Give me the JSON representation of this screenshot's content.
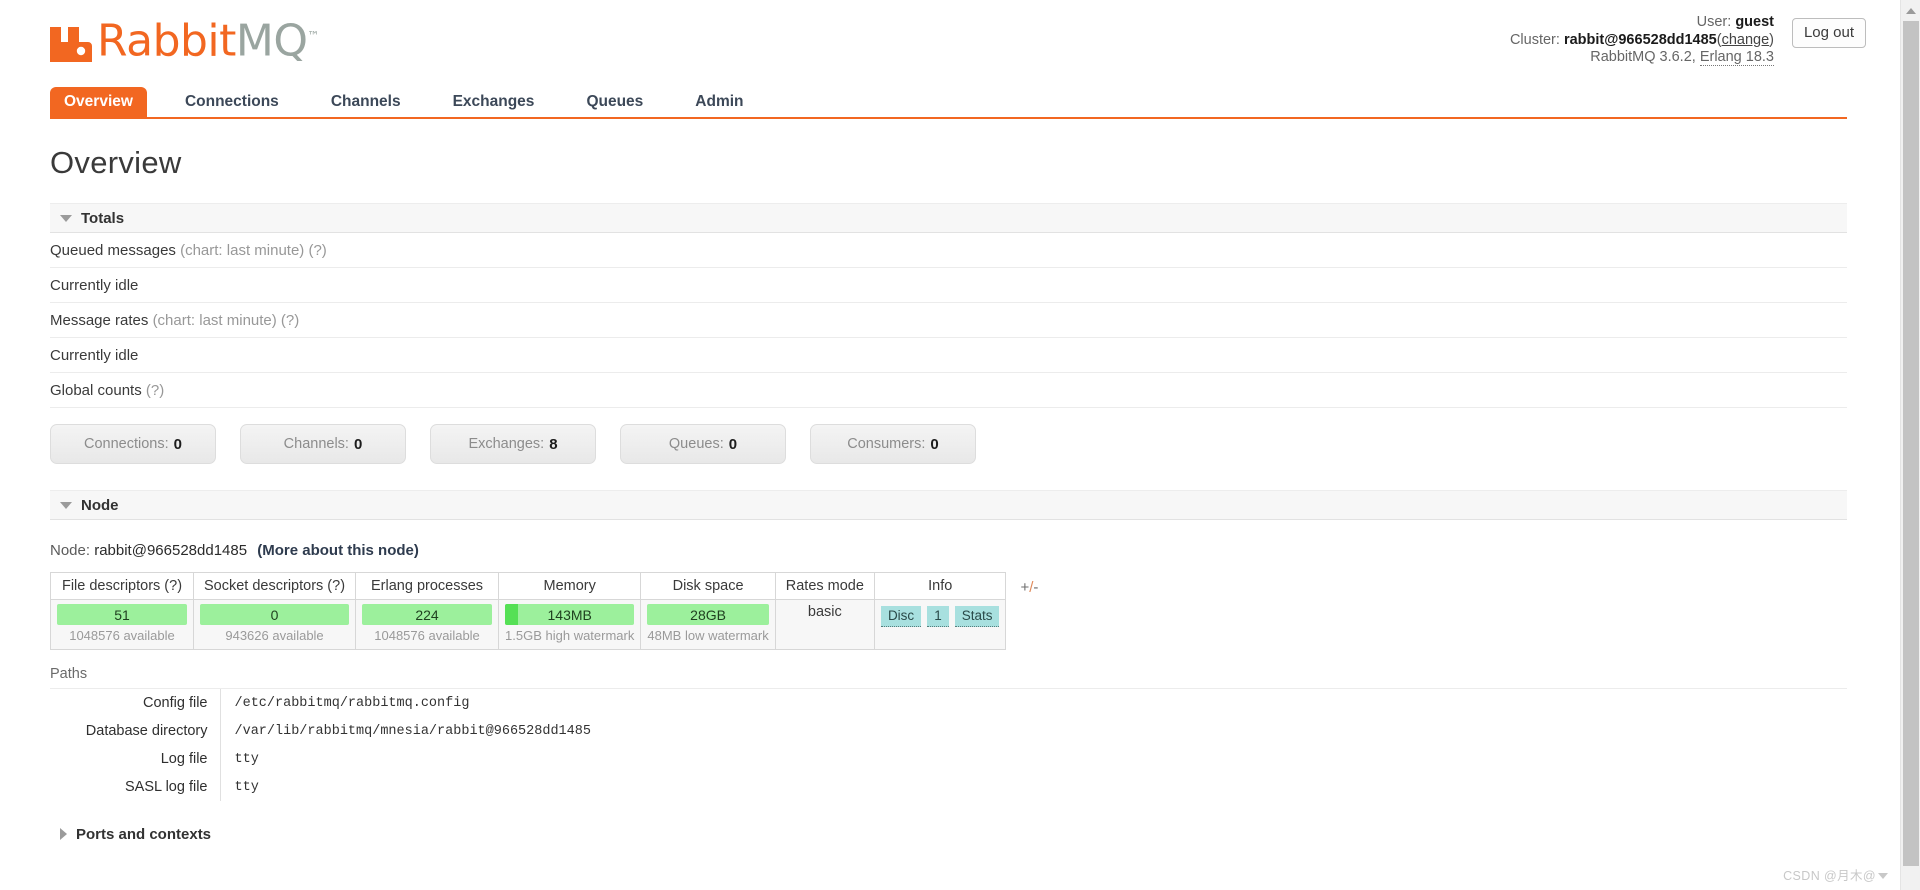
{
  "brand": {
    "name_primary": "Rabbit",
    "name_secondary": "MQ",
    "trademark": "™",
    "accent_color": "#f26721",
    "secondary_color": "#9aa5a0"
  },
  "header": {
    "user_label": "User:",
    "user_value": "guest",
    "cluster_label": "Cluster:",
    "cluster_value": "rabbit@966528dd1485",
    "cluster_change_open": "(",
    "cluster_change_link": "change",
    "cluster_change_close": ")",
    "version_prefix": "RabbitMQ 3.6.2,",
    "erlang_version": "Erlang 18.3",
    "logout_label": "Log out"
  },
  "tabs": [
    {
      "label": "Overview",
      "active": true
    },
    {
      "label": "Connections",
      "active": false
    },
    {
      "label": "Channels",
      "active": false
    },
    {
      "label": "Exchanges",
      "active": false
    },
    {
      "label": "Queues",
      "active": false
    },
    {
      "label": "Admin",
      "active": false
    }
  ],
  "page": {
    "title": "Overview"
  },
  "totals": {
    "section_title": "Totals",
    "queued_messages_label": "Queued messages",
    "queued_messages_note": "(chart: last minute) (?)",
    "queued_messages_status": "Currently idle",
    "message_rates_label": "Message rates",
    "message_rates_note": "(chart: last minute) (?)",
    "message_rates_status": "Currently idle",
    "global_counts_label": "Global counts",
    "global_counts_note": "(?)",
    "counts": [
      {
        "label": "Connections:",
        "value": "0"
      },
      {
        "label": "Channels:",
        "value": "0"
      },
      {
        "label": "Exchanges:",
        "value": "8"
      },
      {
        "label": "Queues:",
        "value": "0"
      },
      {
        "label": "Consumers:",
        "value": "0"
      }
    ]
  },
  "node": {
    "section_title": "Node",
    "node_label": "Node:",
    "node_name": "rabbit@966528dd1485",
    "more_link": "(More about this node)",
    "plus_minus": "+/-",
    "columns": [
      "File descriptors (?)",
      "Socket descriptors (?)",
      "Erlang processes",
      "Memory",
      "Disk space",
      "Rates mode",
      "Info"
    ],
    "stats": {
      "file_descriptors": {
        "value": "51",
        "note": "1048576 available",
        "fill_pct": 0
      },
      "socket_descriptors": {
        "value": "0",
        "note": "943626 available",
        "fill_pct": 0
      },
      "erlang_processes": {
        "value": "224",
        "note": "1048576 available",
        "fill_pct": 0
      },
      "memory": {
        "value": "143MB",
        "note": "1.5GB high watermark",
        "fill_pct": 10
      },
      "disk_space": {
        "value": "28GB",
        "note": "48MB low watermark",
        "fill_pct": 0
      },
      "rates_mode": {
        "value": "basic"
      },
      "info_badges": [
        "Disc",
        "1",
        "Stats"
      ]
    }
  },
  "paths": {
    "label": "Paths",
    "rows": [
      {
        "label": "Config file",
        "value": "/etc/rabbitmq/rabbitmq.config"
      },
      {
        "label": "Database directory",
        "value": "/var/lib/rabbitmq/mnesia/rabbit@966528dd1485"
      },
      {
        "label": "Log file",
        "value": "tty"
      },
      {
        "label": "SASL log file",
        "value": "tty"
      }
    ]
  },
  "ports_section": {
    "title": "Ports and contexts"
  },
  "watermark": {
    "text": "CSDN @月木@"
  }
}
